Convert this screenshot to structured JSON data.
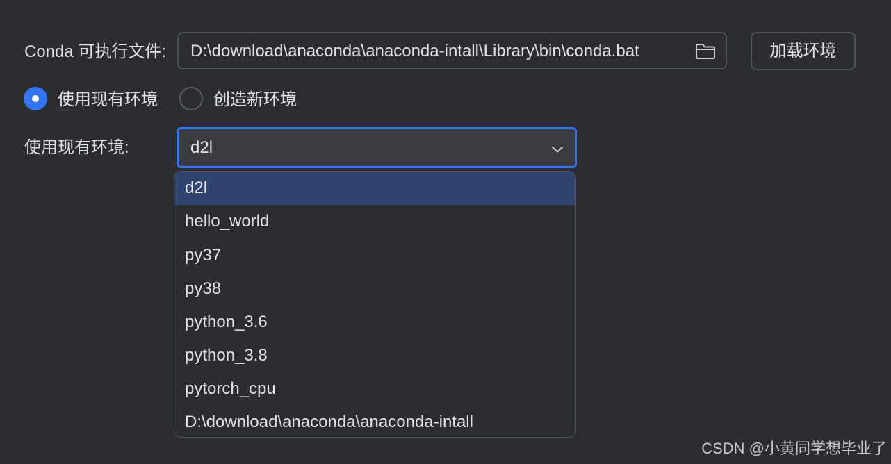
{
  "conda": {
    "label": "Conda 可执行文件:",
    "path_value": "D:\\download\\anaconda\\anaconda-intall\\Library\\bin\\conda.bat",
    "browse_icon": "folder-icon",
    "load_button_label": "加载环境"
  },
  "mode": {
    "use_existing_label": "使用现有环境",
    "use_existing_selected": true,
    "create_new_label": "创造新环境",
    "create_new_selected": false
  },
  "env_select": {
    "label": "使用现有环境:",
    "value": "d2l",
    "dropdown_icon": "chevron-down-icon",
    "options": [
      "d2l",
      "hello_world",
      "py37",
      "py38",
      "python_3.6",
      "python_3.8",
      "pytorch_cpu",
      "D:\\download\\anaconda\\anaconda-intall"
    ],
    "selected_index": 0
  },
  "watermark": "CSDN @小黄同学想毕业了",
  "colors": {
    "background": "#2b2d30",
    "accent": "#3574f0",
    "selection": "#2e436e",
    "text": "#dfe1e5",
    "border": "#4e5157"
  }
}
